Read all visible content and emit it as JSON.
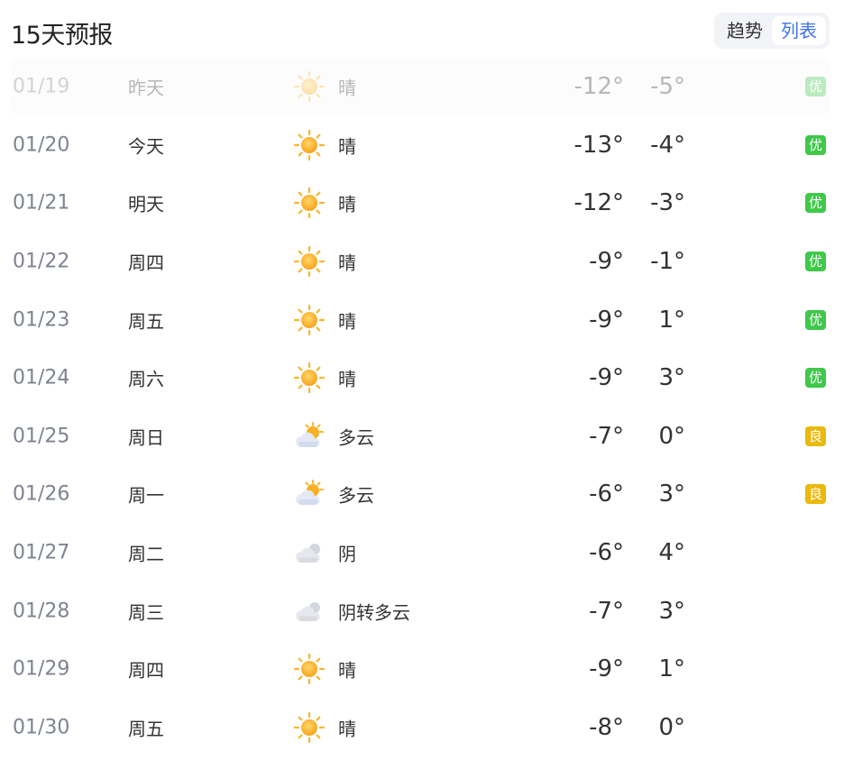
{
  "header": {
    "title": "15天预报",
    "toggle": [
      "趋势",
      "列表"
    ],
    "active_index": 1
  },
  "rows": [
    {
      "date": "01/19",
      "day": "昨天",
      "icon": "sun-icon",
      "cond": "晴",
      "low": "-12°",
      "high": "-5°",
      "aqi": "优",
      "aqi_level": "good",
      "past": true
    },
    {
      "date": "01/20",
      "day": "今天",
      "icon": "sun-icon",
      "cond": "晴",
      "low": "-13°",
      "high": "-4°",
      "aqi": "优",
      "aqi_level": "good"
    },
    {
      "date": "01/21",
      "day": "明天",
      "icon": "sun-icon",
      "cond": "晴",
      "low": "-12°",
      "high": "-3°",
      "aqi": "优",
      "aqi_level": "good"
    },
    {
      "date": "01/22",
      "day": "周四",
      "icon": "sun-icon",
      "cond": "晴",
      "low": "-9°",
      "high": "-1°",
      "aqi": "优",
      "aqi_level": "good"
    },
    {
      "date": "01/23",
      "day": "周五",
      "icon": "sun-icon",
      "cond": "晴",
      "low": "-9°",
      "high": "1°",
      "aqi": "优",
      "aqi_level": "good"
    },
    {
      "date": "01/24",
      "day": "周六",
      "icon": "sun-icon",
      "cond": "晴",
      "low": "-9°",
      "high": "3°",
      "aqi": "优",
      "aqi_level": "good"
    },
    {
      "date": "01/25",
      "day": "周日",
      "icon": "partly-cloudy-icon",
      "cond": "多云",
      "low": "-7°",
      "high": "0°",
      "aqi": "良",
      "aqi_level": "mod"
    },
    {
      "date": "01/26",
      "day": "周一",
      "icon": "partly-cloudy-icon",
      "cond": "多云",
      "low": "-6°",
      "high": "3°",
      "aqi": "良",
      "aqi_level": "mod"
    },
    {
      "date": "01/27",
      "day": "周二",
      "icon": "cloud-icon",
      "cond": "阴",
      "low": "-6°",
      "high": "4°",
      "aqi": "",
      "aqi_level": "none"
    },
    {
      "date": "01/28",
      "day": "周三",
      "icon": "cloud-icon",
      "cond": "阴转多云",
      "low": "-7°",
      "high": "3°",
      "aqi": "",
      "aqi_level": "none"
    },
    {
      "date": "01/29",
      "day": "周四",
      "icon": "sun-icon",
      "cond": "晴",
      "low": "-9°",
      "high": "1°",
      "aqi": "",
      "aqi_level": "none"
    },
    {
      "date": "01/30",
      "day": "周五",
      "icon": "sun-icon",
      "cond": "晴",
      "low": "-8°",
      "high": "0°",
      "aqi": "",
      "aqi_level": "none"
    }
  ]
}
